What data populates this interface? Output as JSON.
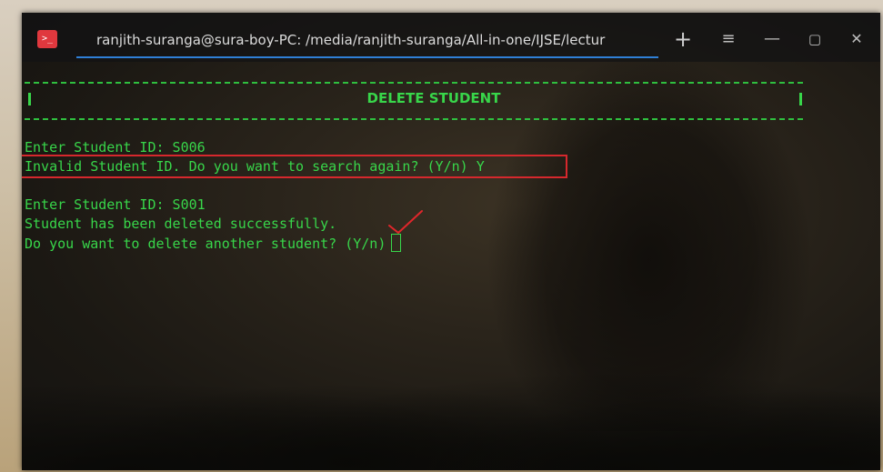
{
  "window": {
    "tab_title": "ranjith-suranga@sura-boy-PC: /media/ranjith-suranga/All-in-one/IJSE/lectur",
    "app_icon_glyph": ">_",
    "buttons": {
      "add": "+",
      "menu": "≡",
      "minimize": "—",
      "maximize": "▢",
      "close": "✕"
    },
    "accent_color": "#2f7fd6"
  },
  "terminal": {
    "header_title": "DELETE STUDENT",
    "border_char": "|",
    "lines": [
      "Enter Student ID: S006",
      "Invalid Student ID. Do you want to search again? (Y/n) Y",
      "Enter Student ID: S001",
      "Student has been deleted successfully.",
      "Do you want to delete another student? (Y/n)"
    ],
    "text_color": "#38d64a",
    "highlight_color": "#d6282d"
  },
  "icons": {
    "app": "terminal-icon",
    "annotation": "checkmark-icon"
  }
}
